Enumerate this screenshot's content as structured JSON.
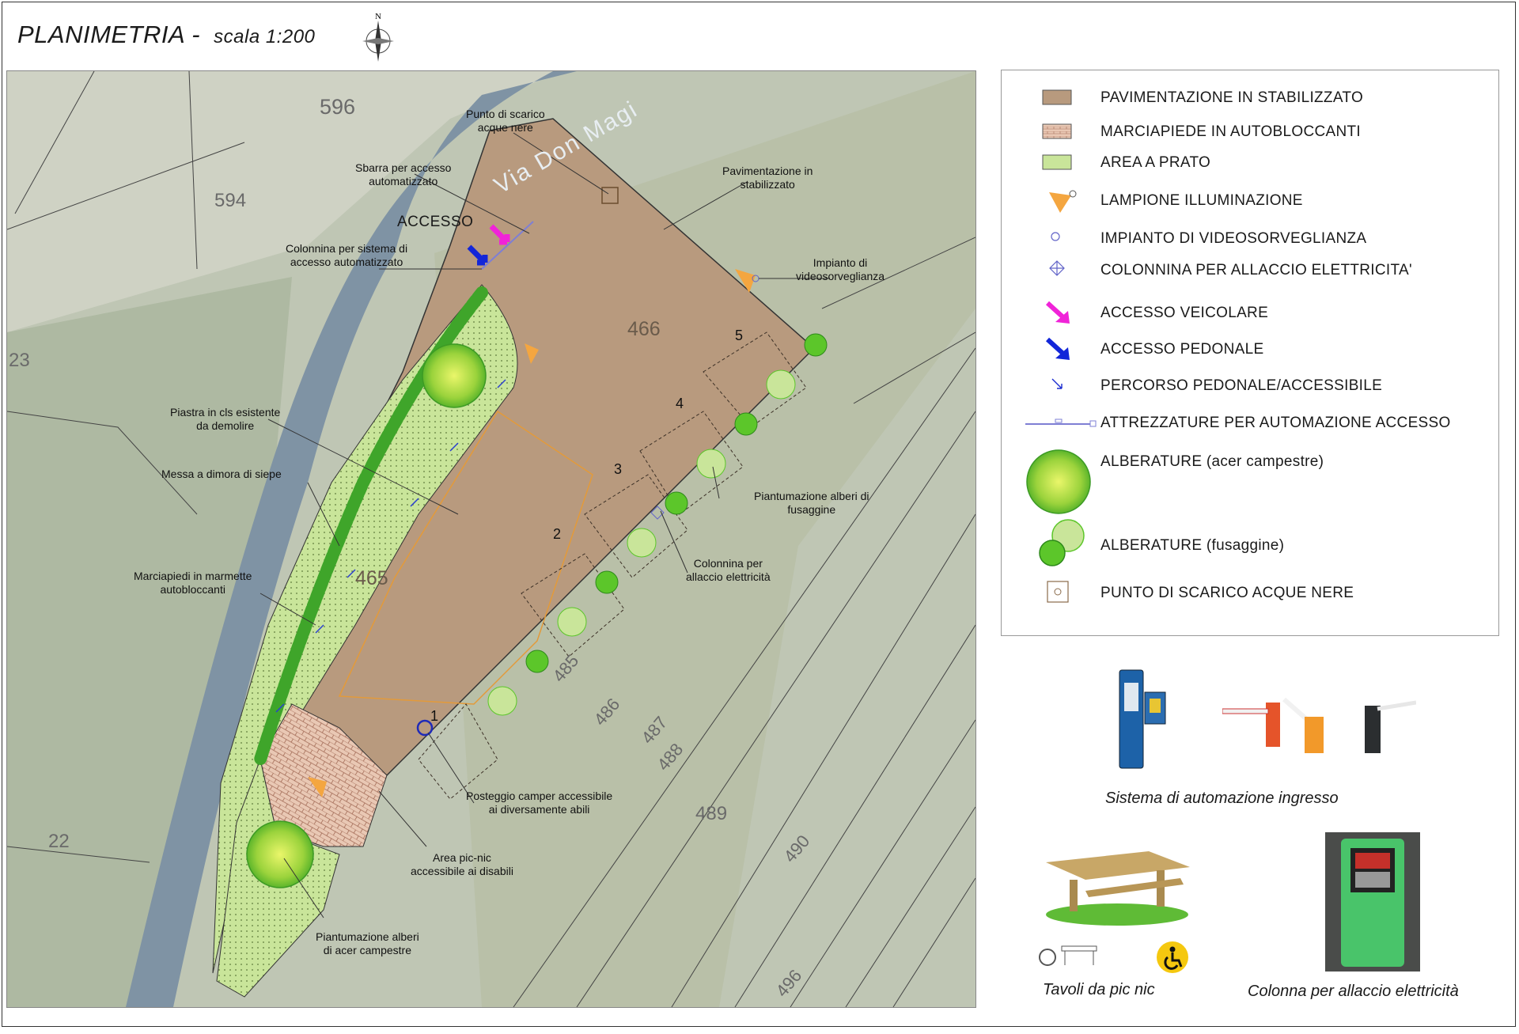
{
  "title": {
    "main": "PLANIMETRIA",
    "separator": "-",
    "scale": "scala 1:200"
  },
  "compass_letter": "N",
  "map": {
    "cadastral_numbers": [
      "596",
      "594",
      "23",
      "466",
      "465",
      "22",
      "485",
      "486",
      "487",
      "488",
      "489",
      "490",
      "496"
    ],
    "street_name": "Via Don Magi",
    "access_label": "ACCESSO",
    "stall_numbers": [
      "1",
      "2",
      "3",
      "4",
      "5"
    ],
    "annotations": [
      {
        "lines": [
          "Punto di scarico",
          "acque nere"
        ]
      },
      {
        "lines": [
          "Sbarra per accesso",
          "automatizzato"
        ]
      },
      {
        "lines": [
          "Pavimentazione in",
          "stabilizzato"
        ]
      },
      {
        "lines": [
          "Colonnina per sistema di",
          "accesso automatizzato"
        ]
      },
      {
        "lines": [
          "Impianto di",
          "videosorveglianza"
        ]
      },
      {
        "lines": [
          "Piastra in cls esistente",
          "da demolire"
        ]
      },
      {
        "lines": [
          "Messa a dimora di siepe"
        ]
      },
      {
        "lines": [
          "Piantumazione alberi di",
          "fusaggine"
        ]
      },
      {
        "lines": [
          "Colonnina per",
          "allaccio elettricità"
        ]
      },
      {
        "lines": [
          "Marciapiedi in marmette",
          "autobloccanti"
        ]
      },
      {
        "lines": [
          "Posteggio camper accessibile",
          "ai diversamente abili"
        ]
      },
      {
        "lines": [
          "Area pic-nic",
          "accessibile ai disabili"
        ]
      },
      {
        "lines": [
          "Piantumazione alberi",
          "di acer campestre"
        ]
      }
    ]
  },
  "legend": {
    "items": [
      {
        "symbol": "stabilizzato-swatch",
        "label": "PAVIMENTAZIONE IN STABILIZZATO",
        "sub": ""
      },
      {
        "symbol": "autobloccanti-swatch",
        "label": "MARCIAPIEDE IN AUTOBLOCCANTI",
        "sub": ""
      },
      {
        "symbol": "prato-swatch",
        "label": "AREA A PRATO",
        "sub": ""
      },
      {
        "symbol": "lamp-icon",
        "label": "LAMPIONE ILLUMINAZIONE",
        "sub": ""
      },
      {
        "symbol": "camera-circle-icon",
        "label": "IMPIANTO DI VIDEOSORVEGLIANZA",
        "sub": ""
      },
      {
        "symbol": "power-column-icon",
        "label": "COLONNINA PER ALLACCIO ELETTRICITA'",
        "sub": ""
      },
      {
        "symbol": "vehicle-arrow-icon",
        "label": "ACCESSO VEICOLARE",
        "sub": ""
      },
      {
        "symbol": "pedestrian-arrow-icon",
        "label": "ACCESSO PEDONALE",
        "sub": ""
      },
      {
        "symbol": "path-arrow-icon",
        "label": "PERCORSO PEDONALE/ACCESSIBILE",
        "sub": ""
      },
      {
        "symbol": "barrier-line-icon",
        "label": "ATTREZZATURE PER AUTOMAZIONE ACCESSO",
        "sub": ""
      },
      {
        "symbol": "maple-tree-icon",
        "label": "ALBERATURE",
        "sub": "(acer campestre)"
      },
      {
        "symbol": "spindle-tree-icon",
        "label": "ALBERATURE",
        "sub": "(fusaggine)"
      },
      {
        "symbol": "drain-point-icon",
        "label": "PUNTO DI SCARICO ACQUE NERE",
        "sub": ""
      }
    ]
  },
  "captions": {
    "automation": "Sistema di automazione ingresso",
    "picnic": "Tavoli da pic nic",
    "power": "Colonna per allaccio elettricità"
  },
  "colors": {
    "stabilizzato": "#b89a7e",
    "prato": "#c9e59a",
    "vehicle_access": "#f023d8",
    "pedestrian_access": "#1226d9",
    "tree": "#5cc62a",
    "lamp": "#f4a640"
  }
}
